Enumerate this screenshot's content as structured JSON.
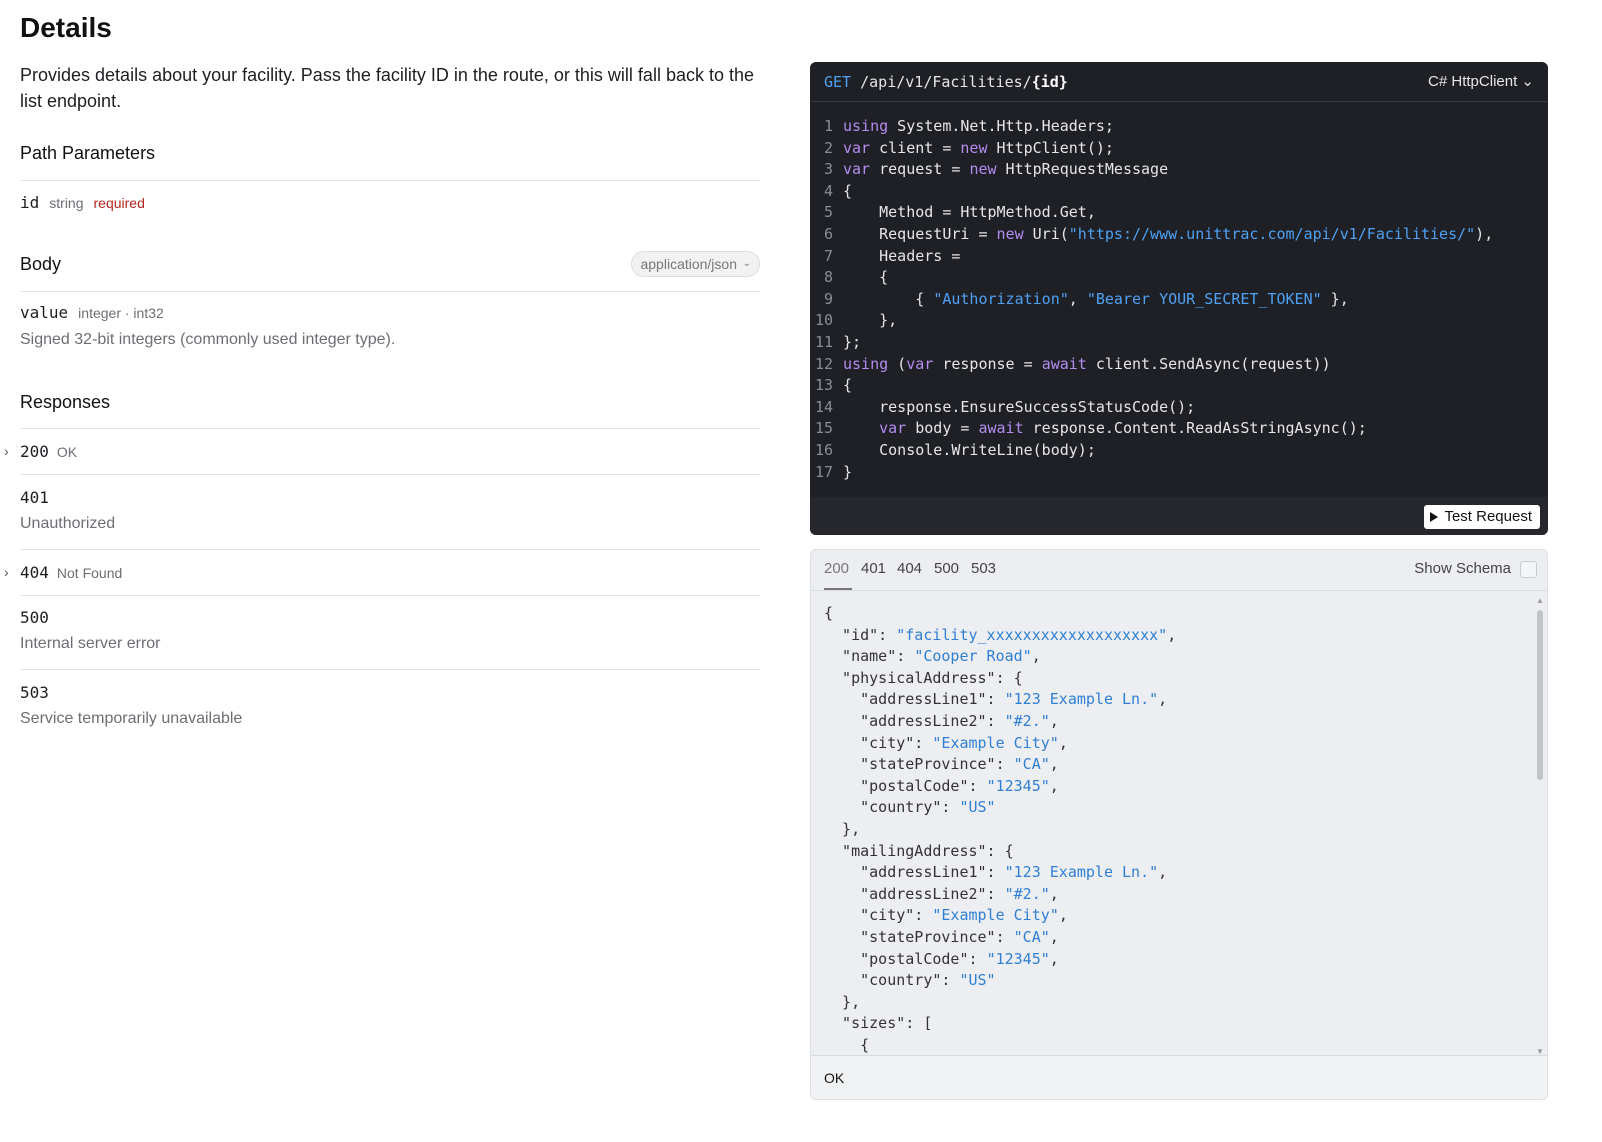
{
  "page": {
    "title": "Details",
    "description": "Provides details about your facility. Pass the facility ID in the route, or this will fall back to the list endpoint."
  },
  "path_parameters": {
    "heading": "Path Parameters",
    "params": [
      {
        "name": "id",
        "type": "string",
        "required": "required"
      }
    ]
  },
  "body": {
    "heading": "Body",
    "content_type": "application/json",
    "field": {
      "name": "value",
      "type": "integer · int32",
      "description": "Signed 32-bit integers (commonly used integer type)."
    }
  },
  "responses": {
    "heading": "Responses",
    "items": [
      {
        "code": "200",
        "label": "OK",
        "description": ""
      },
      {
        "code": "401",
        "label": "",
        "description": "Unauthorized"
      },
      {
        "code": "404",
        "label": "Not Found",
        "description": ""
      },
      {
        "code": "500",
        "label": "",
        "description": "Internal server error"
      },
      {
        "code": "503",
        "label": "",
        "description": "Service temporarily unavailable"
      }
    ]
  },
  "code_panel": {
    "method": "GET",
    "path": "/api/v1/Facilities/",
    "path_param": "{id}",
    "language": "C# HttpClient",
    "test_button": "Test Request",
    "lines": [
      [
        {
          "t": "kw",
          "v": "using"
        },
        {
          "t": "p",
          "v": " System.Net.Http.Headers;"
        }
      ],
      [
        {
          "t": "kw",
          "v": "var"
        },
        {
          "t": "p",
          "v": " client = "
        },
        {
          "t": "kw",
          "v": "new"
        },
        {
          "t": "p",
          "v": " HttpClient();"
        }
      ],
      [
        {
          "t": "kw",
          "v": "var"
        },
        {
          "t": "p",
          "v": " request = "
        },
        {
          "t": "kw",
          "v": "new"
        },
        {
          "t": "p",
          "v": " HttpRequestMessage"
        }
      ],
      [
        {
          "t": "p",
          "v": "{"
        }
      ],
      [
        {
          "t": "p",
          "v": "    Method = HttpMethod.Get,"
        }
      ],
      [
        {
          "t": "p",
          "v": "    RequestUri = "
        },
        {
          "t": "kw",
          "v": "new"
        },
        {
          "t": "p",
          "v": " Uri("
        },
        {
          "t": "str",
          "v": "\"https://www.unittrac.com/api/v1/Facilities/\""
        },
        {
          "t": "p",
          "v": "),"
        }
      ],
      [
        {
          "t": "p",
          "v": "    Headers ="
        }
      ],
      [
        {
          "t": "p",
          "v": "    {"
        }
      ],
      [
        {
          "t": "p",
          "v": "        { "
        },
        {
          "t": "str",
          "v": "\"Authorization\""
        },
        {
          "t": "p",
          "v": ", "
        },
        {
          "t": "str",
          "v": "\"Bearer YOUR_SECRET_TOKEN\""
        },
        {
          "t": "p",
          "v": " },"
        }
      ],
      [
        {
          "t": "p",
          "v": "    },"
        }
      ],
      [
        {
          "t": "p",
          "v": "};"
        }
      ],
      [
        {
          "t": "kw",
          "v": "using"
        },
        {
          "t": "p",
          "v": " ("
        },
        {
          "t": "kw",
          "v": "var"
        },
        {
          "t": "p",
          "v": " response = "
        },
        {
          "t": "kw",
          "v": "await"
        },
        {
          "t": "p",
          "v": " client.SendAsync(request))"
        }
      ],
      [
        {
          "t": "p",
          "v": "{"
        }
      ],
      [
        {
          "t": "p",
          "v": "    response.EnsureSuccessStatusCode();"
        }
      ],
      [
        {
          "t": "p",
          "v": "    "
        },
        {
          "t": "kw",
          "v": "var"
        },
        {
          "t": "p",
          "v": " body = "
        },
        {
          "t": "kw",
          "v": "await"
        },
        {
          "t": "p",
          "v": " response.Content.ReadAsStringAsync();"
        }
      ],
      [
        {
          "t": "p",
          "v": "    Console.WriteLine(body);"
        }
      ],
      [
        {
          "t": "p",
          "v": "}"
        }
      ]
    ]
  },
  "response_panel": {
    "tabs": [
      "200",
      "401",
      "404",
      "500",
      "503"
    ],
    "active_tab": "200",
    "show_schema_label": "Show Schema",
    "status_text": "OK",
    "json_lines": [
      [
        {
          "t": "p",
          "v": "{"
        }
      ],
      [
        {
          "t": "p",
          "v": "  \"id\": "
        },
        {
          "t": "s",
          "v": "\"facility_xxxxxxxxxxxxxxxxxxx\""
        },
        {
          "t": "p",
          "v": ","
        }
      ],
      [
        {
          "t": "p",
          "v": "  \"name\": "
        },
        {
          "t": "s",
          "v": "\"Cooper Road\""
        },
        {
          "t": "p",
          "v": ","
        }
      ],
      [
        {
          "t": "p",
          "v": "  \"physicalAddress\": {"
        }
      ],
      [
        {
          "t": "p",
          "v": "    \"addressLine1\": "
        },
        {
          "t": "s",
          "v": "\"123 Example Ln.\""
        },
        {
          "t": "p",
          "v": ","
        }
      ],
      [
        {
          "t": "p",
          "v": "    \"addressLine2\": "
        },
        {
          "t": "s",
          "v": "\"#2.\""
        },
        {
          "t": "p",
          "v": ","
        }
      ],
      [
        {
          "t": "p",
          "v": "    \"city\": "
        },
        {
          "t": "s",
          "v": "\"Example City\""
        },
        {
          "t": "p",
          "v": ","
        }
      ],
      [
        {
          "t": "p",
          "v": "    \"stateProvince\": "
        },
        {
          "t": "s",
          "v": "\"CA\""
        },
        {
          "t": "p",
          "v": ","
        }
      ],
      [
        {
          "t": "p",
          "v": "    \"postalCode\": "
        },
        {
          "t": "s",
          "v": "\"12345\""
        },
        {
          "t": "p",
          "v": ","
        }
      ],
      [
        {
          "t": "p",
          "v": "    \"country\": "
        },
        {
          "t": "s",
          "v": "\"US\""
        }
      ],
      [
        {
          "t": "p",
          "v": "  },"
        }
      ],
      [
        {
          "t": "p",
          "v": "  \"mailingAddress\": {"
        }
      ],
      [
        {
          "t": "p",
          "v": "    \"addressLine1\": "
        },
        {
          "t": "s",
          "v": "\"123 Example Ln.\""
        },
        {
          "t": "p",
          "v": ","
        }
      ],
      [
        {
          "t": "p",
          "v": "    \"addressLine2\": "
        },
        {
          "t": "s",
          "v": "\"#2.\""
        },
        {
          "t": "p",
          "v": ","
        }
      ],
      [
        {
          "t": "p",
          "v": "    \"city\": "
        },
        {
          "t": "s",
          "v": "\"Example City\""
        },
        {
          "t": "p",
          "v": ","
        }
      ],
      [
        {
          "t": "p",
          "v": "    \"stateProvince\": "
        },
        {
          "t": "s",
          "v": "\"CA\""
        },
        {
          "t": "p",
          "v": ","
        }
      ],
      [
        {
          "t": "p",
          "v": "    \"postalCode\": "
        },
        {
          "t": "s",
          "v": "\"12345\""
        },
        {
          "t": "p",
          "v": ","
        }
      ],
      [
        {
          "t": "p",
          "v": "    \"country\": "
        },
        {
          "t": "s",
          "v": "\"US\""
        }
      ],
      [
        {
          "t": "p",
          "v": "  },"
        }
      ],
      [
        {
          "t": "p",
          "v": "  \"sizes\": ["
        }
      ],
      [
        {
          "t": "p",
          "v": "    {"
        }
      ]
    ]
  },
  "icons": {
    "expand": "chevron-right-icon",
    "dropdown": "chevron-down-icon",
    "play": "play-icon"
  },
  "colors": {
    "code_bg": "#1e2026",
    "keyword": "#b58cf0",
    "string": "#4ea1f3",
    "required": "#b3261e"
  }
}
